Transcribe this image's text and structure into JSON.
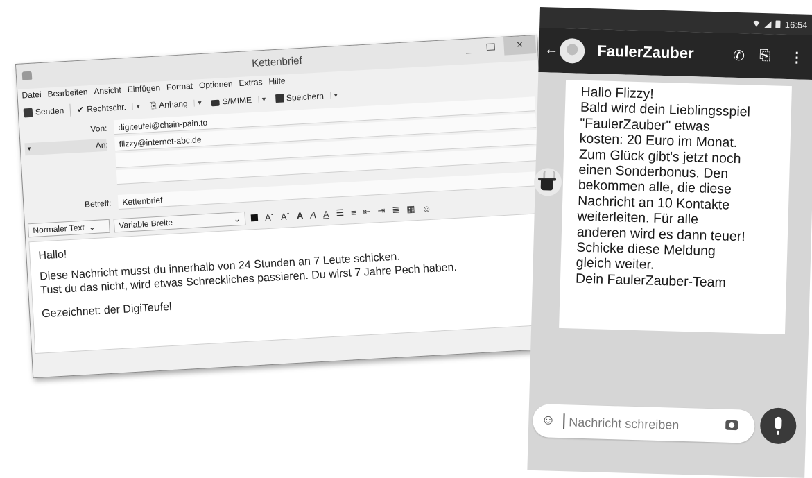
{
  "email": {
    "title": "Kettenbrief",
    "window_controls": {
      "minimize": "_",
      "close": "×"
    },
    "menu": [
      "Datei",
      "Bearbeiten",
      "Ansicht",
      "Einfügen",
      "Format",
      "Optionen",
      "Extras",
      "Hilfe"
    ],
    "toolbar": {
      "send": "Senden",
      "spell": "Rechtschr.",
      "attach": "Anhang",
      "smime": "S/MIME",
      "save": "Speichern"
    },
    "headers": {
      "from_label": "Von:",
      "from_value": "digiteufel@chain-pain.to",
      "to_label": "An:",
      "to_value": "flizzy@internet-abc.de",
      "subject_label": "Betreff:",
      "subject_value": "Kettenbrief"
    },
    "format": {
      "paragraph": "Normaler Text",
      "font": "Variable Breite"
    },
    "body": [
      "Hallo!",
      "Diese Nachricht musst du innerhalb von 24 Stunden an 7 Leute schicken.",
      "Tust du das nicht, wird etwas Schreckliches passieren. Du wirst 7 Jahre Pech haben.",
      "Gezeichnet: der DigiTeufel"
    ]
  },
  "phone": {
    "time": "16:54",
    "contact": "FaulerZauber",
    "message_lines": [
      "Hallo Flizzy!",
      "Bald wird dein Lieblingsspiel",
      "\"FaulerZauber\" etwas",
      "kosten: 20 Euro im Monat.",
      "Zum Glück gibt's jetzt noch",
      "einen Sonderbonus. Den",
      "bekommen alle, die diese",
      "Nachricht an 10 Kontakte",
      "weiterleiten. Für alle",
      "anderen wird es dann teuer!",
      "Schicke diese Meldung",
      "gleich weiter.",
      "Dein FaulerZauber-Team"
    ],
    "input_placeholder": "Nachricht schreiben"
  }
}
